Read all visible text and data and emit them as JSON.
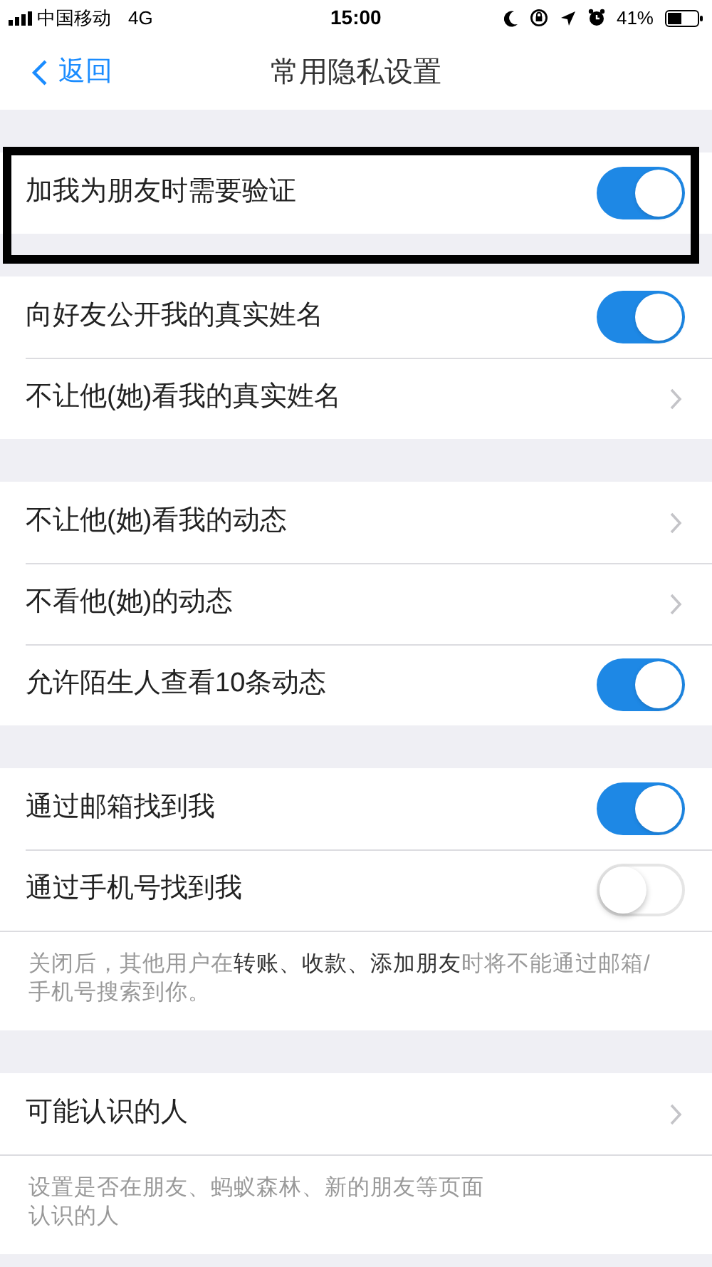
{
  "status_bar": {
    "carrier": "中国移动",
    "network": "4G",
    "time": "15:00",
    "battery": "41%"
  },
  "nav": {
    "back": "返回",
    "title": "常用隐私设置"
  },
  "sections": [
    {
      "highlight": true,
      "rows": [
        {
          "kind": "toggle",
          "label": "加我为朋友时需要验证",
          "on": true
        }
      ]
    },
    {
      "highlight": false,
      "rows": [
        {
          "kind": "toggle",
          "label": "向好友公开我的真实姓名",
          "on": true
        },
        {
          "kind": "link",
          "label": "不让他(她)看我的真实姓名"
        }
      ]
    },
    {
      "highlight": false,
      "rows": [
        {
          "kind": "link",
          "label": "不让他(她)看我的动态"
        },
        {
          "kind": "link",
          "label": "不看他(她)的动态"
        },
        {
          "kind": "toggle",
          "label": "允许陌生人查看10条动态",
          "on": true
        }
      ]
    },
    {
      "highlight": false,
      "rows": [
        {
          "kind": "toggle",
          "label": "通过邮箱找到我",
          "on": true
        },
        {
          "kind": "toggle",
          "label": "通过手机号找到我",
          "on": false
        }
      ],
      "note": [
        "关闭后，其他用户在**转账、收款、添加朋友**时将不能通过邮箱/手机号搜索到你。"
      ]
    },
    {
      "highlight": false,
      "rows": [
        {
          "kind": "link",
          "label": "可能认识的人"
        }
      ],
      "note": [
        "设置是否在朋友、蚂蚁森林、新的朋友等页面",
        "认识的人"
      ]
    }
  ]
}
